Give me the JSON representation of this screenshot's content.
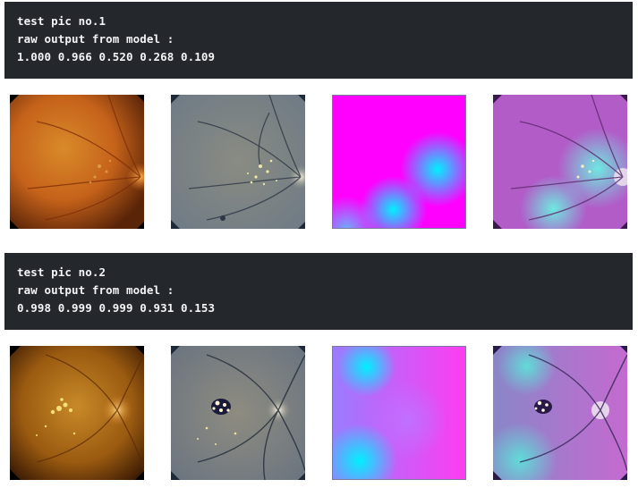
{
  "samples": [
    {
      "title": "test pic no.1",
      "label": "raw output from model :",
      "values": "1.000 0.966 0.520 0.268 0.109",
      "panels": [
        {
          "name": "original-fundus",
          "icon": "retina-image"
        },
        {
          "name": "preprocessed-fundus",
          "icon": "retina-image"
        },
        {
          "name": "attention-heatmap",
          "icon": "heatmap-image"
        },
        {
          "name": "heatmap-overlay",
          "icon": "retina-image"
        }
      ]
    },
    {
      "title": "test pic no.2",
      "label": "raw output from model :",
      "values": "0.998 0.999 0.999 0.931 0.153",
      "panels": [
        {
          "name": "original-fundus",
          "icon": "retina-image"
        },
        {
          "name": "preprocessed-fundus",
          "icon": "retina-image"
        },
        {
          "name": "attention-heatmap",
          "icon": "heatmap-image"
        },
        {
          "name": "heatmap-overlay",
          "icon": "retina-image"
        }
      ]
    }
  ],
  "colors": {
    "output_background": "#24272c",
    "output_text": "#f3f4f6",
    "heatmap_high": "#ff00ff",
    "heatmap_low": "#00f0ff"
  }
}
